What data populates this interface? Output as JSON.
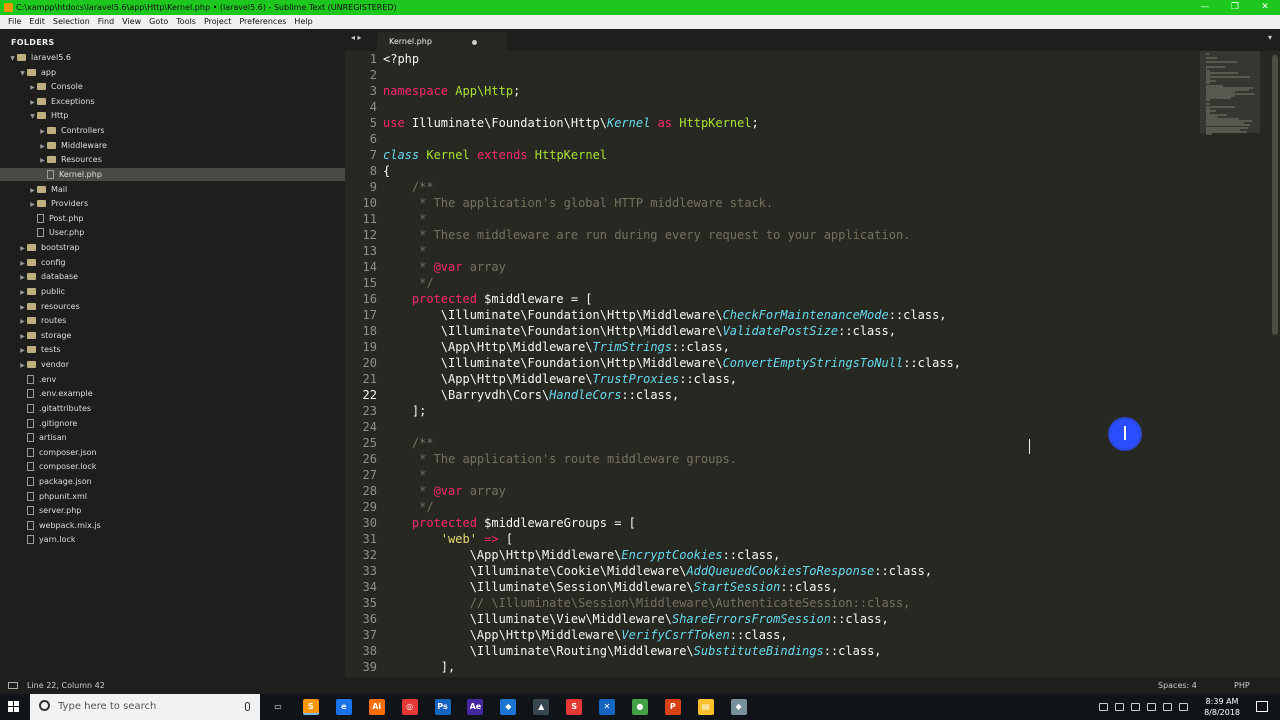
{
  "window": {
    "title": "C:\\xampp\\htdocs\\laravel5.6\\app\\Http\\Kernel.php • (laravel5.6) - Sublime Text (UNREGISTERED)",
    "min_glyph": "—",
    "max_glyph": "❐",
    "close_glyph": "✕"
  },
  "menu": [
    "File",
    "Edit",
    "Selection",
    "Find",
    "View",
    "Goto",
    "Tools",
    "Project",
    "Preferences",
    "Help"
  ],
  "sidebar": {
    "title": "FOLDERS",
    "tree": [
      {
        "label": "laravel5.6",
        "depth": 0,
        "type": "folder",
        "open": true
      },
      {
        "label": "app",
        "depth": 1,
        "type": "folder",
        "open": true
      },
      {
        "label": "Console",
        "depth": 2,
        "type": "folder",
        "open": false
      },
      {
        "label": "Exceptions",
        "depth": 2,
        "type": "folder",
        "open": false
      },
      {
        "label": "Http",
        "depth": 2,
        "type": "folder",
        "open": true
      },
      {
        "label": "Controllers",
        "depth": 3,
        "type": "folder",
        "open": false
      },
      {
        "label": "Middleware",
        "depth": 3,
        "type": "folder",
        "open": false
      },
      {
        "label": "Resources",
        "depth": 3,
        "type": "folder",
        "open": false
      },
      {
        "label": "Kernel.php",
        "depth": 3,
        "type": "file",
        "selected": true
      },
      {
        "label": "Mail",
        "depth": 2,
        "type": "folder",
        "open": false
      },
      {
        "label": "Providers",
        "depth": 2,
        "type": "folder",
        "open": false
      },
      {
        "label": "Post.php",
        "depth": 2,
        "type": "file"
      },
      {
        "label": "User.php",
        "depth": 2,
        "type": "file"
      },
      {
        "label": "bootstrap",
        "depth": 1,
        "type": "folder",
        "open": false
      },
      {
        "label": "config",
        "depth": 1,
        "type": "folder",
        "open": false
      },
      {
        "label": "database",
        "depth": 1,
        "type": "folder",
        "open": false
      },
      {
        "label": "public",
        "depth": 1,
        "type": "folder",
        "open": false
      },
      {
        "label": "resources",
        "depth": 1,
        "type": "folder",
        "open": false
      },
      {
        "label": "routes",
        "depth": 1,
        "type": "folder",
        "open": false
      },
      {
        "label": "storage",
        "depth": 1,
        "type": "folder",
        "open": false
      },
      {
        "label": "tests",
        "depth": 1,
        "type": "folder",
        "open": false
      },
      {
        "label": "vendor",
        "depth": 1,
        "type": "folder",
        "open": false
      },
      {
        "label": ".env",
        "depth": 1,
        "type": "file"
      },
      {
        "label": ".env.example",
        "depth": 1,
        "type": "file"
      },
      {
        "label": ".gitattributes",
        "depth": 1,
        "type": "file"
      },
      {
        "label": ".gitignore",
        "depth": 1,
        "type": "file"
      },
      {
        "label": "artisan",
        "depth": 1,
        "type": "file"
      },
      {
        "label": "composer.json",
        "depth": 1,
        "type": "file"
      },
      {
        "label": "composer.lock",
        "depth": 1,
        "type": "file"
      },
      {
        "label": "package.json",
        "depth": 1,
        "type": "file"
      },
      {
        "label": "phpunit.xml",
        "depth": 1,
        "type": "file"
      },
      {
        "label": "server.php",
        "depth": 1,
        "type": "file"
      },
      {
        "label": "webpack.mix.js",
        "depth": 1,
        "type": "file"
      },
      {
        "label": "yarn.lock",
        "depth": 1,
        "type": "file"
      }
    ]
  },
  "tabs": [
    {
      "label": "Kernel.php",
      "modified": true
    }
  ],
  "tab_nav": "◂ ▸",
  "tab_menu": "▾",
  "editor": {
    "current_line": 22,
    "lines": [
      [
        [
          "t-plain",
          "<?php"
        ]
      ],
      [],
      [
        [
          "t-kw",
          "namespace"
        ],
        [
          "t-plain",
          " "
        ],
        [
          "t-ns",
          "App\\Http"
        ],
        [
          "t-plain",
          ";"
        ]
      ],
      [],
      [
        [
          "t-kw",
          "use"
        ],
        [
          "t-plain",
          " Illuminate\\Foundation\\Http\\"
        ],
        [
          "t-ital",
          "Kernel"
        ],
        [
          "t-plain",
          " "
        ],
        [
          "t-kw",
          "as"
        ],
        [
          "t-plain",
          " "
        ],
        [
          "t-ns",
          "HttpKernel"
        ],
        [
          "t-plain",
          ";"
        ]
      ],
      [],
      [
        [
          "t-cls",
          "class"
        ],
        [
          "t-plain",
          " "
        ],
        [
          "t-ns",
          "Kernel"
        ],
        [
          "t-plain",
          " "
        ],
        [
          "t-kw",
          "extends"
        ],
        [
          "t-plain",
          " "
        ],
        [
          "t-ns",
          "HttpKernel"
        ]
      ],
      [
        [
          "t-plain",
          "{"
        ]
      ],
      [
        [
          "t-cmt",
          "    /**"
        ]
      ],
      [
        [
          "t-cmt",
          "     * The application's global HTTP middleware stack."
        ]
      ],
      [
        [
          "t-cmt",
          "     *"
        ]
      ],
      [
        [
          "t-cmt",
          "     * These middleware are run during every request to your application."
        ]
      ],
      [
        [
          "t-cmt",
          "     *"
        ]
      ],
      [
        [
          "t-cmt",
          "     * "
        ],
        [
          "t-kw",
          "@var"
        ],
        [
          "t-cmt",
          " array"
        ]
      ],
      [
        [
          "t-cmt",
          "     */"
        ]
      ],
      [
        [
          "t-plain",
          "    "
        ],
        [
          "t-kw",
          "protected"
        ],
        [
          "t-plain",
          " $middleware = ["
        ]
      ],
      [
        [
          "t-plain",
          "        \\Illuminate\\Foundation\\Http\\Middleware\\"
        ],
        [
          "t-ital",
          "CheckForMaintenanceMode"
        ],
        [
          "t-plain",
          "::class,"
        ]
      ],
      [
        [
          "t-plain",
          "        \\Illuminate\\Foundation\\Http\\Middleware\\"
        ],
        [
          "t-ital",
          "ValidatePostSize"
        ],
        [
          "t-plain",
          "::class,"
        ]
      ],
      [
        [
          "t-plain",
          "        \\App\\Http\\Middleware\\"
        ],
        [
          "t-ital",
          "TrimStrings"
        ],
        [
          "t-plain",
          "::class,"
        ]
      ],
      [
        [
          "t-plain",
          "        \\Illuminate\\Foundation\\Http\\Middleware\\"
        ],
        [
          "t-ital",
          "ConvertEmptyStringsToNull"
        ],
        [
          "t-plain",
          "::class,"
        ]
      ],
      [
        [
          "t-plain",
          "        \\App\\Http\\Middleware\\"
        ],
        [
          "t-ital",
          "TrustProxies"
        ],
        [
          "t-plain",
          "::class,"
        ]
      ],
      [
        [
          "t-plain",
          "        \\Barryvdh\\Cors\\"
        ],
        [
          "t-ital",
          "HandleCors"
        ],
        [
          "t-plain",
          "::class,"
        ]
      ],
      [
        [
          "t-plain",
          "    ];"
        ]
      ],
      [],
      [
        [
          "t-cmt",
          "    /**"
        ]
      ],
      [
        [
          "t-cmt",
          "     * The application's route middleware groups."
        ]
      ],
      [
        [
          "t-cmt",
          "     *"
        ]
      ],
      [
        [
          "t-cmt",
          "     * "
        ],
        [
          "t-kw",
          "@var"
        ],
        [
          "t-cmt",
          " array"
        ]
      ],
      [
        [
          "t-cmt",
          "     */"
        ]
      ],
      [
        [
          "t-plain",
          "    "
        ],
        [
          "t-kw",
          "protected"
        ],
        [
          "t-plain",
          " $middlewareGroups = ["
        ]
      ],
      [
        [
          "t-plain",
          "        "
        ],
        [
          "t-str",
          "'web'"
        ],
        [
          "t-plain",
          " "
        ],
        [
          "t-kw",
          "=>"
        ],
        [
          "t-plain",
          " ["
        ]
      ],
      [
        [
          "t-plain",
          "            \\App\\Http\\Middleware\\"
        ],
        [
          "t-ital",
          "EncryptCookies"
        ],
        [
          "t-plain",
          "::class,"
        ]
      ],
      [
        [
          "t-plain",
          "            \\Illuminate\\Cookie\\Middleware\\"
        ],
        [
          "t-ital",
          "AddQueuedCookiesToResponse"
        ],
        [
          "t-plain",
          "::class,"
        ]
      ],
      [
        [
          "t-plain",
          "            \\Illuminate\\Session\\Middleware\\"
        ],
        [
          "t-ital",
          "StartSession"
        ],
        [
          "t-plain",
          "::class,"
        ]
      ],
      [
        [
          "t-cmt",
          "            // \\Illuminate\\Session\\Middleware\\AuthenticateSession::class,"
        ]
      ],
      [
        [
          "t-plain",
          "            \\Illuminate\\View\\Middleware\\"
        ],
        [
          "t-ital",
          "ShareErrorsFromSession"
        ],
        [
          "t-plain",
          "::class,"
        ]
      ],
      [
        [
          "t-plain",
          "            \\App\\Http\\Middleware\\"
        ],
        [
          "t-ital",
          "VerifyCsrfToken"
        ],
        [
          "t-plain",
          "::class,"
        ]
      ],
      [
        [
          "t-plain",
          "            \\Illuminate\\Routing\\Middleware\\"
        ],
        [
          "t-ital",
          "SubstituteBindings"
        ],
        [
          "t-plain",
          "::class,"
        ]
      ],
      [
        [
          "t-plain",
          "        ],"
        ]
      ]
    ]
  },
  "status": {
    "position": "Line 22, Column 42",
    "spaces": "Spaces: 4",
    "syntax": "PHP"
  },
  "taskbar": {
    "search_placeholder": "Type here to search",
    "apps": [
      {
        "name": "task-view",
        "label": "▭",
        "color": "#101418"
      },
      {
        "name": "sublime-text",
        "label": "S",
        "color": "#ff9800",
        "active": true
      },
      {
        "name": "edge",
        "label": "e",
        "color": "#1a73e8"
      },
      {
        "name": "illustrator",
        "label": "Ai",
        "color": "#ff6f00"
      },
      {
        "name": "photoshop-mix",
        "label": "◎",
        "color": "#e53935"
      },
      {
        "name": "photoshop",
        "label": "Ps",
        "color": "#1565c0"
      },
      {
        "name": "after-effects",
        "label": "Ae",
        "color": "#4527a0"
      },
      {
        "name": "app-generic",
        "label": "◆",
        "color": "#1976d2"
      },
      {
        "name": "app-generic-2",
        "label": "▲",
        "color": "#37474f"
      },
      {
        "name": "app-red",
        "label": "S",
        "color": "#e53935"
      },
      {
        "name": "app-blue",
        "label": "✕",
        "color": "#1565c0"
      },
      {
        "name": "chrome",
        "label": "●",
        "color": "#43a047"
      },
      {
        "name": "powerpoint",
        "label": "P",
        "color": "#d84315"
      },
      {
        "name": "file-explorer",
        "label": "▤",
        "color": "#fbc02d"
      },
      {
        "name": "app-last",
        "label": "◆",
        "color": "#78909c"
      }
    ],
    "time": "8:39 AM",
    "date": "8/8/2018"
  }
}
